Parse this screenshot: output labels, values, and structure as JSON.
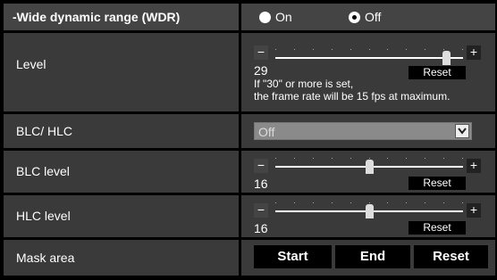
{
  "wdr": {
    "label": "-Wide dynamic range (WDR)",
    "options": [
      "On",
      "Off"
    ],
    "selected": "Off"
  },
  "level": {
    "label": "Level",
    "value": "29",
    "slider_fraction": 0.93,
    "reset_label": "Reset",
    "note_line1": "If \"30\" or more is set,",
    "note_line2": "the frame rate will be 15 fps at maximum."
  },
  "blc_hlc": {
    "label": "BLC/ HLC",
    "selected": "Off"
  },
  "blc_level": {
    "label": "BLC level",
    "value": "16",
    "slider_fraction": 0.5,
    "reset_label": "Reset"
  },
  "hlc_level": {
    "label": "HLC level",
    "value": "16",
    "slider_fraction": 0.5,
    "reset_label": "Reset"
  },
  "mask_area": {
    "label": "Mask area",
    "start_label": "Start",
    "end_label": "End",
    "reset_label": "Reset"
  },
  "icons": {
    "minus": "−",
    "plus": "+",
    "dropdown": "chevron-down-icon"
  },
  "colors": {
    "background": "#000000",
    "cell": "#3a3a3a",
    "header_cell": "#444444",
    "text": "#ffffff"
  }
}
